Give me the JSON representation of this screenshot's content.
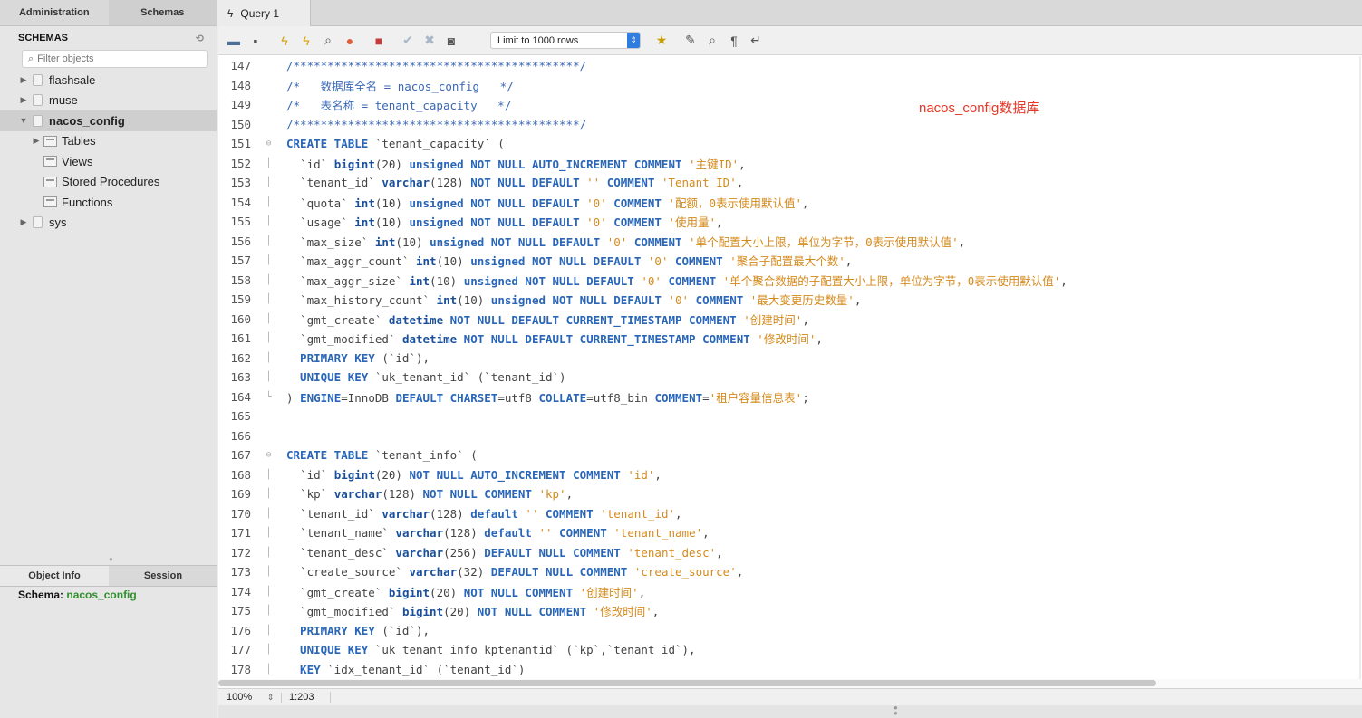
{
  "sidebar": {
    "tabs": [
      {
        "label": "Administration",
        "active": false
      },
      {
        "label": "Schemas",
        "active": true
      }
    ],
    "header": "SCHEMAS",
    "filter_placeholder": "Filter objects",
    "schemas": [
      {
        "label": "flashsale",
        "expanded": false,
        "selected": false
      },
      {
        "label": "muse",
        "expanded": false,
        "selected": false
      },
      {
        "label": "nacos_config",
        "expanded": true,
        "selected": true
      },
      {
        "label": "sys",
        "expanded": false,
        "selected": false
      }
    ],
    "children": [
      {
        "label": "Tables",
        "has_arrow": true
      },
      {
        "label": "Views",
        "has_arrow": false
      },
      {
        "label": "Stored Procedures",
        "has_arrow": false
      },
      {
        "label": "Functions",
        "has_arrow": false
      }
    ],
    "info_tabs": [
      {
        "label": "Object Info",
        "active": true
      },
      {
        "label": "Session",
        "active": false
      }
    ],
    "schema_info_label": "Schema:",
    "schema_info_value": "nacos_config"
  },
  "query_tab": {
    "label": "Query 1"
  },
  "toolbar": {
    "limit_label": "Limit to 1000 rows"
  },
  "annotation": "nacos_config数据库",
  "status": {
    "zoom": "100%",
    "position": "1:203"
  },
  "colors": {
    "keyword": "#2a66b8",
    "string": "#d58a1c",
    "comment": "#3a68b3",
    "annotation": "#e8382a",
    "schema_value": "#2f8f2f"
  },
  "code_lines": [
    {
      "n": "147",
      "fold": "",
      "t": [
        [
          "cm",
          "/******************************************/"
        ]
      ]
    },
    {
      "n": "148",
      "fold": "",
      "t": [
        [
          "cm",
          "/*   数据库全名 = nacos_config   */"
        ]
      ]
    },
    {
      "n": "149",
      "fold": "",
      "t": [
        [
          "cm",
          "/*   表名称 = tenant_capacity   */"
        ]
      ]
    },
    {
      "n": "150",
      "fold": "",
      "t": [
        [
          "cm",
          "/******************************************/"
        ]
      ]
    },
    {
      "n": "151",
      "fold": "open",
      "t": [
        [
          "kw",
          "CREATE TABLE "
        ],
        [
          "nm",
          "`tenant_capacity` ("
        ]
      ]
    },
    {
      "n": "152",
      "fold": "bar",
      "t": [
        [
          "nm",
          "  `id` "
        ],
        [
          "ty",
          "bigint"
        ],
        [
          "nm",
          "(20) "
        ],
        [
          "kw",
          "unsigned NOT NULL AUTO_INCREMENT COMMENT "
        ],
        [
          "str",
          "'主键ID'"
        ],
        [
          "nm",
          ","
        ]
      ]
    },
    {
      "n": "153",
      "fold": "bar",
      "t": [
        [
          "nm",
          "  `tenant_id` "
        ],
        [
          "ty",
          "varchar"
        ],
        [
          "nm",
          "(128) "
        ],
        [
          "kw",
          "NOT NULL DEFAULT "
        ],
        [
          "str",
          "''"
        ],
        [
          "kw",
          " COMMENT "
        ],
        [
          "str",
          "'Tenant ID'"
        ],
        [
          "nm",
          ","
        ]
      ]
    },
    {
      "n": "154",
      "fold": "bar",
      "t": [
        [
          "nm",
          "  `quota` "
        ],
        [
          "ty",
          "int"
        ],
        [
          "nm",
          "(10) "
        ],
        [
          "kw",
          "unsigned NOT NULL DEFAULT "
        ],
        [
          "str",
          "'0'"
        ],
        [
          "kw",
          " COMMENT "
        ],
        [
          "str",
          "'配额，0表示使用默认值'"
        ],
        [
          "nm",
          ","
        ]
      ]
    },
    {
      "n": "155",
      "fold": "bar",
      "t": [
        [
          "nm",
          "  `usage` "
        ],
        [
          "ty",
          "int"
        ],
        [
          "nm",
          "(10) "
        ],
        [
          "kw",
          "unsigned NOT NULL DEFAULT "
        ],
        [
          "str",
          "'0'"
        ],
        [
          "kw",
          " COMMENT "
        ],
        [
          "str",
          "'使用量'"
        ],
        [
          "nm",
          ","
        ]
      ]
    },
    {
      "n": "156",
      "fold": "bar",
      "t": [
        [
          "nm",
          "  `max_size` "
        ],
        [
          "ty",
          "int"
        ],
        [
          "nm",
          "(10) "
        ],
        [
          "kw",
          "unsigned NOT NULL DEFAULT "
        ],
        [
          "str",
          "'0'"
        ],
        [
          "kw",
          " COMMENT "
        ],
        [
          "str",
          "'单个配置大小上限，单位为字节，0表示使用默认值'"
        ],
        [
          "nm",
          ","
        ]
      ]
    },
    {
      "n": "157",
      "fold": "bar",
      "t": [
        [
          "nm",
          "  `max_aggr_count` "
        ],
        [
          "ty",
          "int"
        ],
        [
          "nm",
          "(10) "
        ],
        [
          "kw",
          "unsigned NOT NULL DEFAULT "
        ],
        [
          "str",
          "'0'"
        ],
        [
          "kw",
          " COMMENT "
        ],
        [
          "str",
          "'聚合子配置最大个数'"
        ],
        [
          "nm",
          ","
        ]
      ]
    },
    {
      "n": "158",
      "fold": "bar",
      "t": [
        [
          "nm",
          "  `max_aggr_size` "
        ],
        [
          "ty",
          "int"
        ],
        [
          "nm",
          "(10) "
        ],
        [
          "kw",
          "unsigned NOT NULL DEFAULT "
        ],
        [
          "str",
          "'0'"
        ],
        [
          "kw",
          " COMMENT "
        ],
        [
          "str",
          "'单个聚合数据的子配置大小上限，单位为字节，0表示使用默认值'"
        ],
        [
          "nm",
          ","
        ]
      ]
    },
    {
      "n": "159",
      "fold": "bar",
      "t": [
        [
          "nm",
          "  `max_history_count` "
        ],
        [
          "ty",
          "int"
        ],
        [
          "nm",
          "(10) "
        ],
        [
          "kw",
          "unsigned NOT NULL DEFAULT "
        ],
        [
          "str",
          "'0'"
        ],
        [
          "kw",
          " COMMENT "
        ],
        [
          "str",
          "'最大变更历史数量'"
        ],
        [
          "nm",
          ","
        ]
      ]
    },
    {
      "n": "160",
      "fold": "bar",
      "t": [
        [
          "nm",
          "  `gmt_create` "
        ],
        [
          "ty",
          "datetime"
        ],
        [
          "kw",
          " NOT NULL DEFAULT CURRENT_TIMESTAMP COMMENT "
        ],
        [
          "str",
          "'创建时间'"
        ],
        [
          "nm",
          ","
        ]
      ]
    },
    {
      "n": "161",
      "fold": "bar",
      "t": [
        [
          "nm",
          "  `gmt_modified` "
        ],
        [
          "ty",
          "datetime"
        ],
        [
          "kw",
          " NOT NULL DEFAULT CURRENT_TIMESTAMP COMMENT "
        ],
        [
          "str",
          "'修改时间'"
        ],
        [
          "nm",
          ","
        ]
      ]
    },
    {
      "n": "162",
      "fold": "bar",
      "t": [
        [
          "kw",
          "  PRIMARY KEY "
        ],
        [
          "nm",
          "(`id`),"
        ]
      ]
    },
    {
      "n": "163",
      "fold": "bar",
      "t": [
        [
          "kw",
          "  UNIQUE KEY "
        ],
        [
          "nm",
          "`uk_tenant_id` (`tenant_id`)"
        ]
      ]
    },
    {
      "n": "164",
      "fold": "end",
      "t": [
        [
          "nm",
          ") "
        ],
        [
          "kw",
          "ENGINE"
        ],
        [
          "nm",
          "=InnoDB "
        ],
        [
          "kw",
          "DEFAULT CHARSET"
        ],
        [
          "nm",
          "=utf8 "
        ],
        [
          "kw",
          "COLLATE"
        ],
        [
          "nm",
          "=utf8_bin "
        ],
        [
          "kw",
          "COMMENT"
        ],
        [
          "nm",
          "="
        ],
        [
          "str",
          "'租户容量信息表'"
        ],
        [
          "nm",
          ";"
        ]
      ]
    },
    {
      "n": "165",
      "fold": "",
      "t": []
    },
    {
      "n": "166",
      "fold": "",
      "t": []
    },
    {
      "n": "167",
      "fold": "open",
      "t": [
        [
          "kw",
          "CREATE TABLE "
        ],
        [
          "nm",
          "`tenant_info` ("
        ]
      ]
    },
    {
      "n": "168",
      "fold": "bar",
      "t": [
        [
          "nm",
          "  `id` "
        ],
        [
          "ty",
          "bigint"
        ],
        [
          "nm",
          "(20) "
        ],
        [
          "kw",
          "NOT NULL AUTO_INCREMENT COMMENT "
        ],
        [
          "str",
          "'id'"
        ],
        [
          "nm",
          ","
        ]
      ]
    },
    {
      "n": "169",
      "fold": "bar",
      "t": [
        [
          "nm",
          "  `kp` "
        ],
        [
          "ty",
          "varchar"
        ],
        [
          "nm",
          "(128) "
        ],
        [
          "kw",
          "NOT NULL COMMENT "
        ],
        [
          "str",
          "'kp'"
        ],
        [
          "nm",
          ","
        ]
      ]
    },
    {
      "n": "170",
      "fold": "bar",
      "t": [
        [
          "nm",
          "  `tenant_id` "
        ],
        [
          "ty",
          "varchar"
        ],
        [
          "nm",
          "(128) "
        ],
        [
          "kw",
          "default "
        ],
        [
          "str",
          "''"
        ],
        [
          "kw",
          " COMMENT "
        ],
        [
          "str",
          "'tenant_id'"
        ],
        [
          "nm",
          ","
        ]
      ]
    },
    {
      "n": "171",
      "fold": "bar",
      "t": [
        [
          "nm",
          "  `tenant_name` "
        ],
        [
          "ty",
          "varchar"
        ],
        [
          "nm",
          "(128) "
        ],
        [
          "kw",
          "default "
        ],
        [
          "str",
          "''"
        ],
        [
          "kw",
          " COMMENT "
        ],
        [
          "str",
          "'tenant_name'"
        ],
        [
          "nm",
          ","
        ]
      ]
    },
    {
      "n": "172",
      "fold": "bar",
      "t": [
        [
          "nm",
          "  `tenant_desc` "
        ],
        [
          "ty",
          "varchar"
        ],
        [
          "nm",
          "(256) "
        ],
        [
          "kw",
          "DEFAULT NULL COMMENT "
        ],
        [
          "str",
          "'tenant_desc'"
        ],
        [
          "nm",
          ","
        ]
      ]
    },
    {
      "n": "173",
      "fold": "bar",
      "t": [
        [
          "nm",
          "  `create_source` "
        ],
        [
          "ty",
          "varchar"
        ],
        [
          "nm",
          "(32) "
        ],
        [
          "kw",
          "DEFAULT NULL COMMENT "
        ],
        [
          "str",
          "'create_source'"
        ],
        [
          "nm",
          ","
        ]
      ]
    },
    {
      "n": "174",
      "fold": "bar",
      "t": [
        [
          "nm",
          "  `gmt_create` "
        ],
        [
          "ty",
          "bigint"
        ],
        [
          "nm",
          "(20) "
        ],
        [
          "kw",
          "NOT NULL COMMENT "
        ],
        [
          "str",
          "'创建时间'"
        ],
        [
          "nm",
          ","
        ]
      ]
    },
    {
      "n": "175",
      "fold": "bar",
      "t": [
        [
          "nm",
          "  `gmt_modified` "
        ],
        [
          "ty",
          "bigint"
        ],
        [
          "nm",
          "(20) "
        ],
        [
          "kw",
          "NOT NULL COMMENT "
        ],
        [
          "str",
          "'修改时间'"
        ],
        [
          "nm",
          ","
        ]
      ]
    },
    {
      "n": "176",
      "fold": "bar",
      "t": [
        [
          "kw",
          "  PRIMARY KEY "
        ],
        [
          "nm",
          "(`id`),"
        ]
      ]
    },
    {
      "n": "177",
      "fold": "bar",
      "t": [
        [
          "kw",
          "  UNIQUE KEY "
        ],
        [
          "nm",
          "`uk_tenant_info_kptenantid` (`kp`,`tenant_id`),"
        ]
      ]
    },
    {
      "n": "178",
      "fold": "bar",
      "t": [
        [
          "kw",
          "  KEY "
        ],
        [
          "nm",
          "`idx_tenant_id` (`tenant_id`)"
        ]
      ]
    }
  ]
}
